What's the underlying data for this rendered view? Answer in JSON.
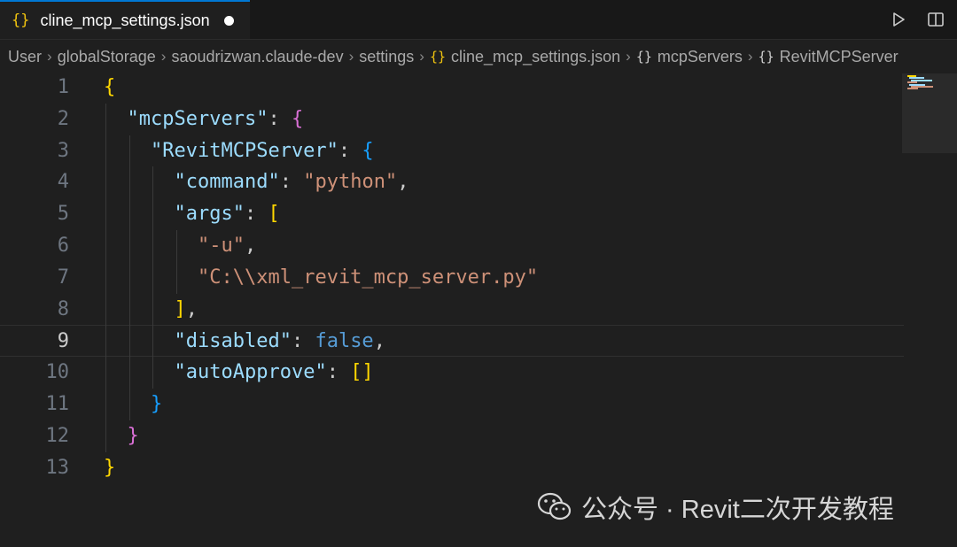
{
  "tab": {
    "icon": "json-braces-icon",
    "icon_glyph": "{}",
    "filename": "cline_mcp_settings.json",
    "modified": true
  },
  "actions": [
    "run-icon",
    "split-editor-icon"
  ],
  "breadcrumb": [
    {
      "label": "User",
      "icon": ""
    },
    {
      "label": "globalStorage",
      "icon": ""
    },
    {
      "label": "saoudrizwan.claude-dev",
      "icon": ""
    },
    {
      "label": "settings",
      "icon": ""
    },
    {
      "label": "cline_mcp_settings.json",
      "icon": "{}"
    },
    {
      "label": "mcpServers",
      "icon": "{}"
    },
    {
      "label": "RevitMCPServer",
      "icon": "{}"
    }
  ],
  "editor": {
    "active_line": 9,
    "lines": [
      {
        "n": "1",
        "indent": 0,
        "tokens": [
          [
            "b1",
            "{"
          ]
        ]
      },
      {
        "n": "2",
        "indent": 1,
        "tokens": [
          [
            "key",
            "\"mcpServers\""
          ],
          [
            "punc",
            ": "
          ],
          [
            "b2",
            "{"
          ]
        ]
      },
      {
        "n": "3",
        "indent": 2,
        "tokens": [
          [
            "key",
            "\"RevitMCPServer\""
          ],
          [
            "punc",
            ": "
          ],
          [
            "b3",
            "{"
          ]
        ]
      },
      {
        "n": "4",
        "indent": 3,
        "tokens": [
          [
            "key",
            "\"command\""
          ],
          [
            "punc",
            ": "
          ],
          [
            "str",
            "\"python\""
          ],
          [
            "punc",
            ","
          ]
        ]
      },
      {
        "n": "5",
        "indent": 3,
        "tokens": [
          [
            "key",
            "\"args\""
          ],
          [
            "punc",
            ": "
          ],
          [
            "b1",
            "["
          ]
        ]
      },
      {
        "n": "6",
        "indent": 4,
        "tokens": [
          [
            "str",
            "\"-u\""
          ],
          [
            "punc",
            ","
          ]
        ]
      },
      {
        "n": "7",
        "indent": 4,
        "tokens": [
          [
            "str",
            "\"C:\\\\xml_revit_mcp_server.py\""
          ]
        ]
      },
      {
        "n": "8",
        "indent": 3,
        "tokens": [
          [
            "b1",
            "]"
          ],
          [
            "punc",
            ","
          ]
        ]
      },
      {
        "n": "9",
        "indent": 3,
        "tokens": [
          [
            "key",
            "\"disabled\""
          ],
          [
            "punc",
            ": "
          ],
          [
            "kw",
            "false"
          ],
          [
            "punc",
            ","
          ]
        ]
      },
      {
        "n": "10",
        "indent": 3,
        "tokens": [
          [
            "key",
            "\"autoApprove\""
          ],
          [
            "punc",
            ": "
          ],
          [
            "b1",
            "[]"
          ]
        ]
      },
      {
        "n": "11",
        "indent": 2,
        "tokens": [
          [
            "b3",
            "}"
          ]
        ]
      },
      {
        "n": "12",
        "indent": 1,
        "tokens": [
          [
            "b2",
            "}"
          ]
        ]
      },
      {
        "n": "13",
        "indent": 0,
        "tokens": [
          [
            "b1",
            "}"
          ]
        ]
      }
    ]
  },
  "watermark": {
    "icon": "wechat-icon",
    "text": "公众号 · Revit二次开发教程"
  },
  "colors": {
    "background": "#1f1f1f",
    "key": "#9cdcfe",
    "string": "#ce9178",
    "keyword": "#569cd6",
    "bracket_level1": "#ffd700",
    "bracket_level2": "#da70d6",
    "bracket_level3": "#179fff"
  }
}
